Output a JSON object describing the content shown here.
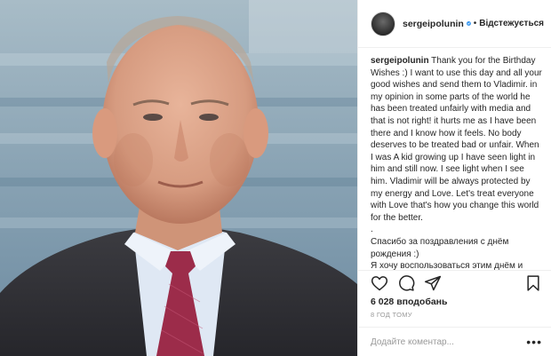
{
  "header": {
    "username": "sergeipolunin",
    "follow_label": "Відстежується",
    "separator": "•"
  },
  "caption": {
    "username": "sergeipolunin",
    "text": "Thank you for the Birthday Wishes :) I want to use this day and all your good wishes and send them to Vladimir. in my opinion in some parts of the world he has been treated unfairly with media and that is not right! it hurts me as I have been there and I know how it feels. No body deserves to be treated bad or unfair. When I was A kid growing up I have seen light in him and still now. I see light when I see him. Vladimir will be always protected by my energy and Love. Let's treat everyone with Love that's how you change this world for the better.",
    "spacer": ".",
    "ru_line1": "Спасибо за поздравления с днём рождения :)",
    "ru_line2": "Я хочу воспользоваться этим днём и направить все ваши добрые пожелания Владимиру."
  },
  "likes": "6 028 вподобань",
  "time_ago": "8 ГОД ТОМУ",
  "comment": {
    "placeholder": "Додайте коментар...",
    "more_label": "•••"
  },
  "colors": {
    "verified": "#3897f0",
    "separator": "#efefef",
    "muted": "#999999"
  },
  "icons": [
    "heart-icon",
    "comment-icon",
    "share-icon",
    "bookmark-icon",
    "verified-badge-icon",
    "more-options-icon"
  ]
}
